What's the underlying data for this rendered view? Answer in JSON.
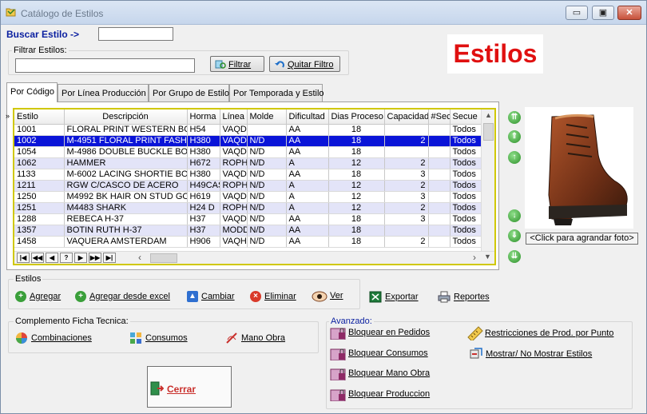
{
  "window": {
    "title": "Catálogo de Estilos",
    "min": "▭",
    "max": "▣",
    "close": "✕"
  },
  "search": {
    "label": "Buscar Estilo ->",
    "value": ""
  },
  "filter": {
    "group_label": "Filtrar Estilos:",
    "value": "",
    "filter_button": "Filtrar",
    "clear_button": "Quitar Filtro"
  },
  "banner": "Estilos",
  "tabs": [
    "Por Código",
    "Por Línea Producción",
    "Por Grupo de Estilo",
    "Por Temporada y Estilo"
  ],
  "grid": {
    "columns": [
      "Estilo",
      "Descripción",
      "Horma",
      "Línea",
      "Molde",
      "Dificultad",
      "Dias Proceso",
      "Capacidad",
      "#Sec",
      "Secue"
    ],
    "rows": [
      [
        "1001",
        "FLORAL PRINT WESTERN BOO",
        "H54",
        "VAQD",
        "",
        "AA",
        "18",
        "",
        "",
        "Todos"
      ],
      [
        "1002",
        "M-4951 FLORAL PRINT FASHIC",
        "H380",
        "VAQD",
        "N/D",
        "AA",
        "18",
        "2",
        "",
        "Todos"
      ],
      [
        "1054",
        "M-4986 DOUBLE BUCKLE BOO",
        "H380",
        "VAQD",
        "N/D",
        "AA",
        "18",
        "",
        "",
        "Todos"
      ],
      [
        "1062",
        "HAMMER",
        "H672",
        "ROPH",
        "N/D",
        "A",
        "12",
        "2",
        "",
        "Todos"
      ],
      [
        "1133",
        "M-6002 LACING SHORTIE BOO",
        "H380",
        "VAQD",
        "N/D",
        "AA",
        "18",
        "3",
        "",
        "Todos"
      ],
      [
        "1211",
        "RGW   C/CASCO DE ACERO",
        "H49CAS",
        "ROPH",
        "N/D",
        "A",
        "12",
        "2",
        "",
        "Todos"
      ],
      [
        "1250",
        "M4992 BK HAIR ON STUD GOR",
        "H619",
        "VAQD",
        "N/D",
        "A",
        "12",
        "3",
        "",
        "Todos"
      ],
      [
        "1251",
        "M4483 SHARK",
        "H24 D",
        "ROPH",
        "N/D",
        "A",
        "12",
        "2",
        "",
        "Todos"
      ],
      [
        "1288",
        "REBECA H-37",
        "H37",
        "VAQD",
        "N/D",
        "AA",
        "18",
        "3",
        "",
        "Todos"
      ],
      [
        "1357",
        "BOTIN RUTH H-37",
        "H37",
        "MODD",
        "N/D",
        "AA",
        "18",
        "",
        "",
        "Todos"
      ],
      [
        "1458",
        "VAQUERA AMSTERDAM",
        "H906",
        "VAQH",
        "N/D",
        "AA",
        "18",
        "2",
        "",
        "Todos"
      ]
    ],
    "selected_row": 1,
    "nav": [
      "|◀",
      "◀◀",
      "◀",
      "?",
      "▶",
      "▶▶",
      "▶|"
    ]
  },
  "photo": {
    "caption": "<Click para agrandar foto>"
  },
  "estilos_group": {
    "label": "Estilos",
    "agregar": "Agregar",
    "agregar_excel": "Agregar desde excel",
    "cambiar": "Cambiar",
    "eliminar": "Eliminar",
    "ver": "Ver"
  },
  "exportar": "Exportar",
  "reportes": "Reportes",
  "complemento": {
    "label": "Complemento Ficha Tecnica:",
    "combinaciones": "Combinaciones",
    "consumos": "Consumos",
    "mano_obra": "Mano Obra"
  },
  "avanzado": {
    "label": "Avanzado:",
    "bloq_pedidos": "Bloquear en Pedidos",
    "bloq_consumos": "Bloquear Consumos",
    "bloq_mano_obra": "Bloquear Mano Obra",
    "bloq_produccion": "Bloquear Produccion",
    "restricciones": "Restricciones de Prod. por Punto",
    "mostrar": "Mostrar/ No Mostrar Estilos"
  },
  "cerrar": "Cerrar",
  "colors": {
    "selected": "#0a14d8",
    "alt_row": "#e3e4f8",
    "banner_text": "#e01010",
    "grid_border": "#d0c800",
    "link_blue": "#0a1fa0"
  }
}
